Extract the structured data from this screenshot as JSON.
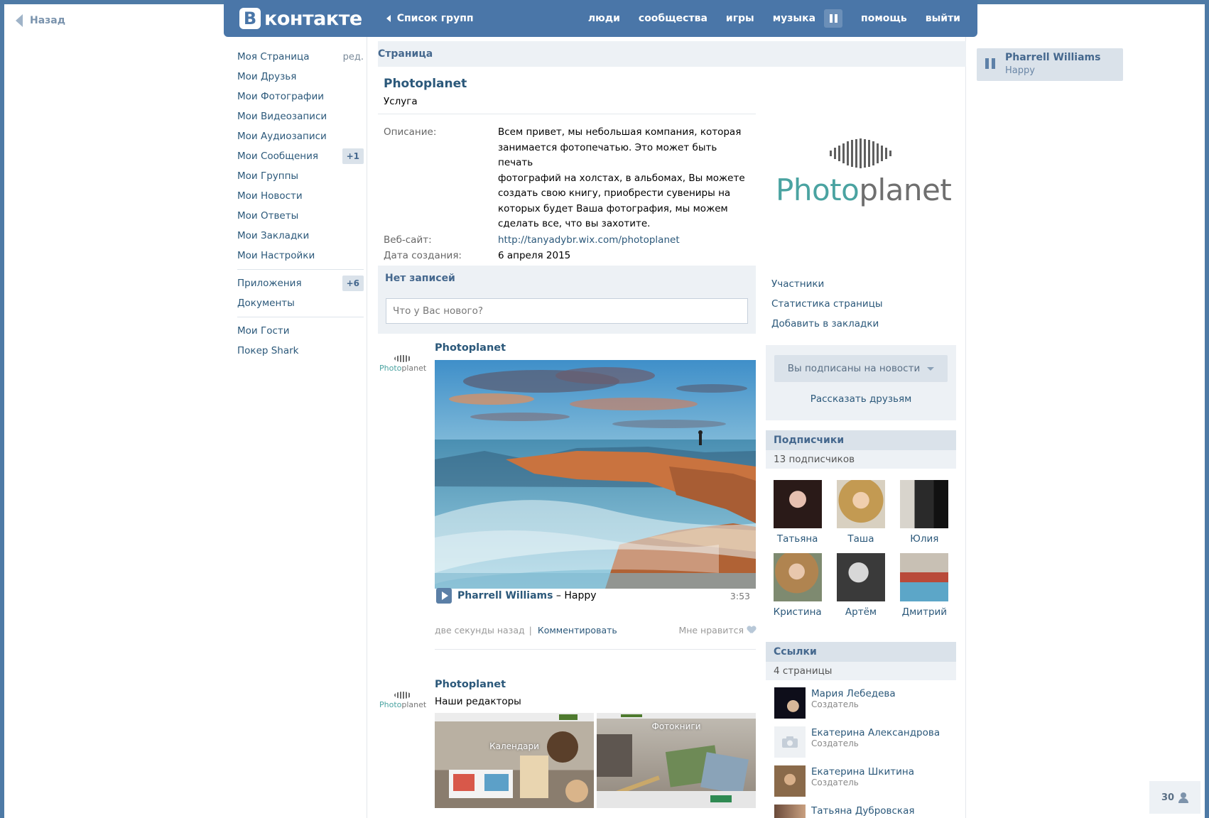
{
  "back_label": "Назад",
  "header": {
    "logo_letter": "В",
    "logo_text": "контакте",
    "groups_link": "Список групп",
    "nav": [
      "люди",
      "сообщества",
      "игры",
      "музыка",
      "помощь",
      "выйти"
    ]
  },
  "left_menu": {
    "items": [
      {
        "label": "Моя Страница",
        "extra": "ред."
      },
      {
        "label": "Мои Друзья"
      },
      {
        "label": "Мои Фотографии"
      },
      {
        "label": "Мои Видеозаписи"
      },
      {
        "label": "Мои Аудиозаписи"
      },
      {
        "label": "Мои Сообщения",
        "badge": "+1"
      },
      {
        "label": "Мои Группы"
      },
      {
        "label": "Мои Новости"
      },
      {
        "label": "Мои Ответы"
      },
      {
        "label": "Мои Закладки"
      },
      {
        "label": "Мои Настройки"
      }
    ],
    "group2": [
      {
        "label": "Приложения",
        "badge": "+6"
      },
      {
        "label": "Документы"
      }
    ],
    "group3": [
      {
        "label": "Мои Гости"
      },
      {
        "label": "Покер Shark"
      }
    ]
  },
  "page": {
    "bar_title": "Страница",
    "title": "Photoplanet",
    "subtitle": "Услуга",
    "info": {
      "desc_label": "Описание:",
      "desc_lines": [
        "Всем привет, мы небольшая компания, которая",
        "занимается фотопечатью. Это может быть печать",
        "фотографий на холстах, в альбомах, Вы можете",
        "создать свою книгу, приобрести сувениры на",
        "которых будет Ваша фотография, мы можем",
        "сделать все, что вы захотите."
      ],
      "site_label": "Веб-сайт:",
      "site_value": "http://tanyadybr.wix.com/photoplanet",
      "date_label": "Дата создания:",
      "date_value": "6 апреля 2015"
    },
    "wall": {
      "title": "Нет записей",
      "placeholder": "Что у Вас нового?"
    },
    "posts": [
      {
        "author": "Photoplanet",
        "audio_artist": "Pharrell Williams",
        "audio_dash": " – ",
        "audio_title": "Happy",
        "audio_duration": "3:53",
        "time": "две секунды назад",
        "comment": "Комментировать",
        "like": "Мне нравится"
      },
      {
        "author": "Photoplanet",
        "text": "Наши редакторы",
        "thumbs": [
          "Календари",
          "Фотокниги"
        ]
      }
    ],
    "avatar_logo": {
      "a": "Photo",
      "b": "planet"
    }
  },
  "side": {
    "logo": {
      "a": "Photo",
      "b": "planet"
    },
    "links": [
      "Участники",
      "Статистика страницы",
      "Добавить в закладки"
    ],
    "subscribe_btn": "Вы подписаны на новости",
    "tell_friends": "Рассказать друзьям",
    "subscribers": {
      "title": "Подписчики",
      "count": "13 подписчиков",
      "people": [
        "Татьяна",
        "Таша",
        "Юлия",
        "Кристина",
        "Артём",
        "Дмитрий"
      ]
    },
    "links_section": {
      "title": "Ссылки",
      "count": "4 страницы",
      "items": [
        {
          "name": "Мария Лебедева",
          "role": "Создатель"
        },
        {
          "name": "Екатерина Александрова",
          "role": "Создатель"
        },
        {
          "name": "Екатерина Шкитина",
          "role": "Создатель"
        },
        {
          "name": "Татьяна Дубровская",
          "role": ""
        }
      ]
    }
  },
  "player": {
    "artist": "Pharrell Williams",
    "song": "Happy"
  },
  "online_count": "30"
}
